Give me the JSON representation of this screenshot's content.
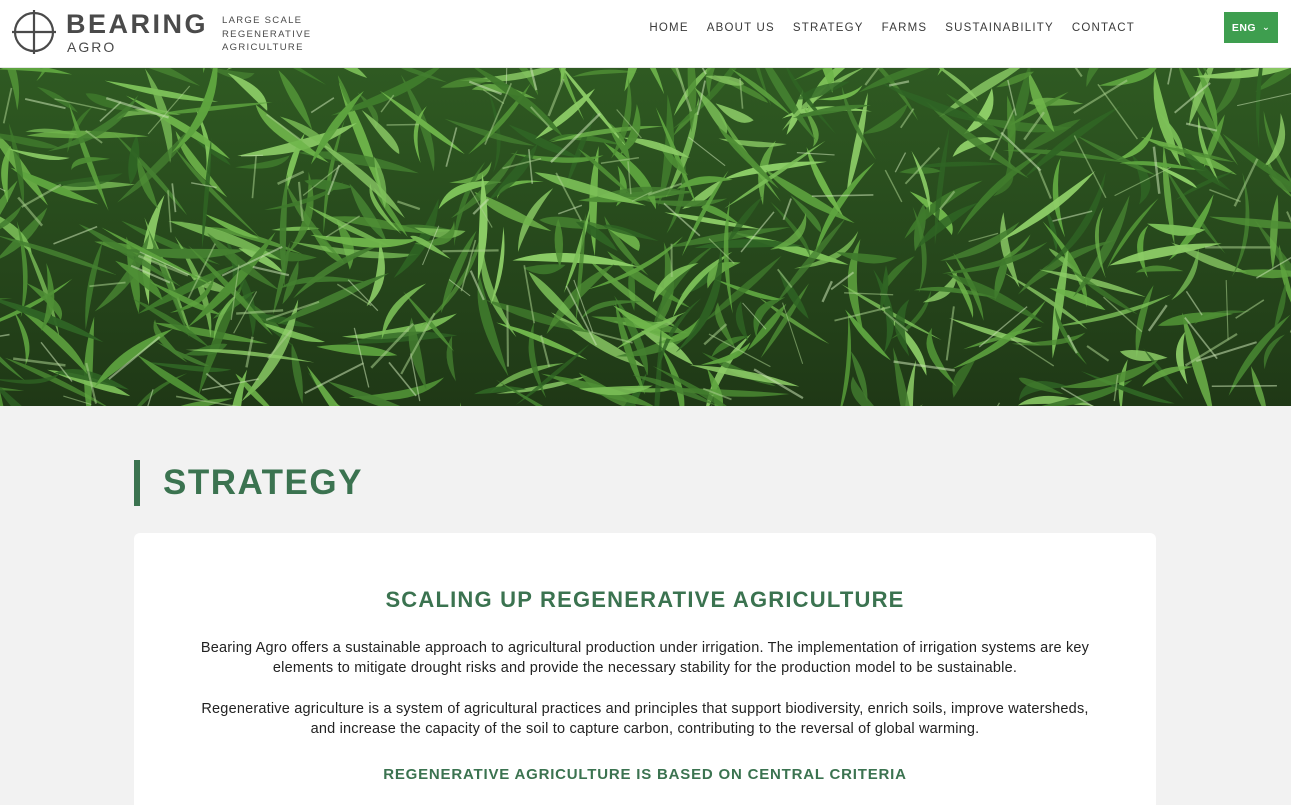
{
  "header": {
    "brand_main": "BEARING",
    "brand_sub": "AGRO",
    "tagline": [
      "LARGE SCALE",
      "REGENERATIVE",
      "AGRICULTURE"
    ],
    "nav": [
      "HOME",
      "ABOUT US",
      "STRATEGY",
      "FARMS",
      "SUSTAINABILITY",
      "CONTACT"
    ],
    "language": "ENG",
    "language_icon": "chevron-down-icon"
  },
  "hero": {
    "image": "corn-field-photo"
  },
  "main": {
    "section_title": "STRATEGY",
    "card": {
      "heading": "SCALING UP REGENERATIVE AGRICULTURE",
      "paragraphs": [
        "Bearing Agro offers a sustainable approach to agricultural production under irrigation. The implementation of irrigation systems are key elements to mitigate drought risks and provide the necessary stability for the production model to be sustainable.",
        "Regenerative agriculture is a system of agricultural practices and principles that support biodiversity, enrich soils, improve watersheds, and increase the capacity of the soil to capture carbon, contributing to the reversal of global warming."
      ],
      "subheading": "REGENERATIVE AGRICULTURE IS BASED ON CENTRAL CRITERIA"
    }
  },
  "colors": {
    "accent_green": "#3b7350",
    "lang_button": "#3e9e4f",
    "page_bg": "#f2f2f2"
  }
}
